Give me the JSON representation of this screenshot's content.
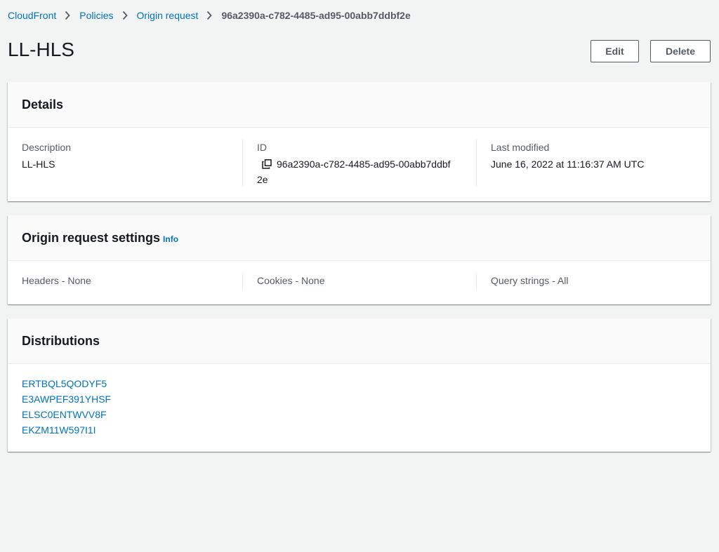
{
  "breadcrumb": {
    "items": [
      "CloudFront",
      "Policies",
      "Origin request"
    ],
    "current": "96a2390a-c782-4485-ad95-00abb7ddbf2e"
  },
  "header": {
    "title": "LL-HLS",
    "edit_label": "Edit",
    "delete_label": "Delete"
  },
  "details": {
    "title": "Details",
    "description_label": "Description",
    "description_value": "LL-HLS",
    "id_label": "ID",
    "id_value_line1": "96a2390a-c782-4485-ad95-00abb7ddbf",
    "id_value_line2": "2e",
    "last_modified_label": "Last modified",
    "last_modified_value": "June 16, 2022 at 11:16:37 AM UTC"
  },
  "settings": {
    "title": "Origin request settings",
    "info_label": "Info",
    "headers": "Headers - None",
    "cookies": "Cookies - None",
    "query_strings": "Query strings - All"
  },
  "distributions": {
    "title": "Distributions",
    "items": [
      "ERTBQL5QODYF5",
      "E3AWPEF391YHSF",
      "ELSC0ENTWVV8F",
      "EKZM11W597I1I"
    ]
  },
  "colors": {
    "link": "#0073bb",
    "background": "#f2f3f3",
    "text": "#16191f",
    "muted": "#545b64"
  },
  "icons": {
    "breadcrumb_separator": "chevron-right-icon",
    "copy": "copy-icon"
  }
}
